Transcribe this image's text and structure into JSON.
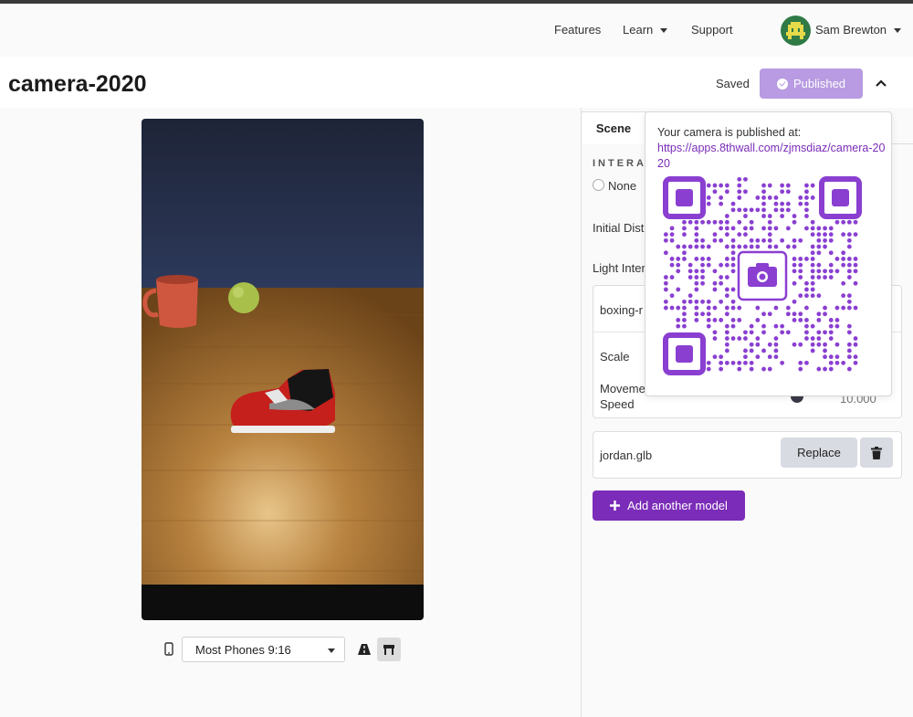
{
  "nav": {
    "features": "Features",
    "learn": "Learn",
    "support": "Support",
    "user_name": "Sam Brewton"
  },
  "header": {
    "title": "camera-2020",
    "saved_status": "Saved",
    "publish_label": "Published"
  },
  "preview": {
    "device_selected": "Most Phones 9:16"
  },
  "panel": {
    "tab_scene": "Scene",
    "interaction_label": "INTERA",
    "radio_none": "None",
    "initial_distance_label": "Initial Dist",
    "light_intensity_label": "Light Inter",
    "model_1_name": "boxing-r",
    "scale_label": "Scale",
    "movement_label_1": "Moveme",
    "movement_label_2": "Speed",
    "movement_value": "10.000",
    "model_2_name": "jordan.glb",
    "replace_label": "Replace",
    "add_model_label": "Add another model"
  },
  "popover": {
    "message": "Your camera is published at:",
    "url": "https://apps.8thwall.com/zjmsdiaz/camera-2020"
  },
  "colors": {
    "accent": "#7b2cb8",
    "publish_disabled": "#b89be2",
    "qr": "#8a3fd1"
  }
}
